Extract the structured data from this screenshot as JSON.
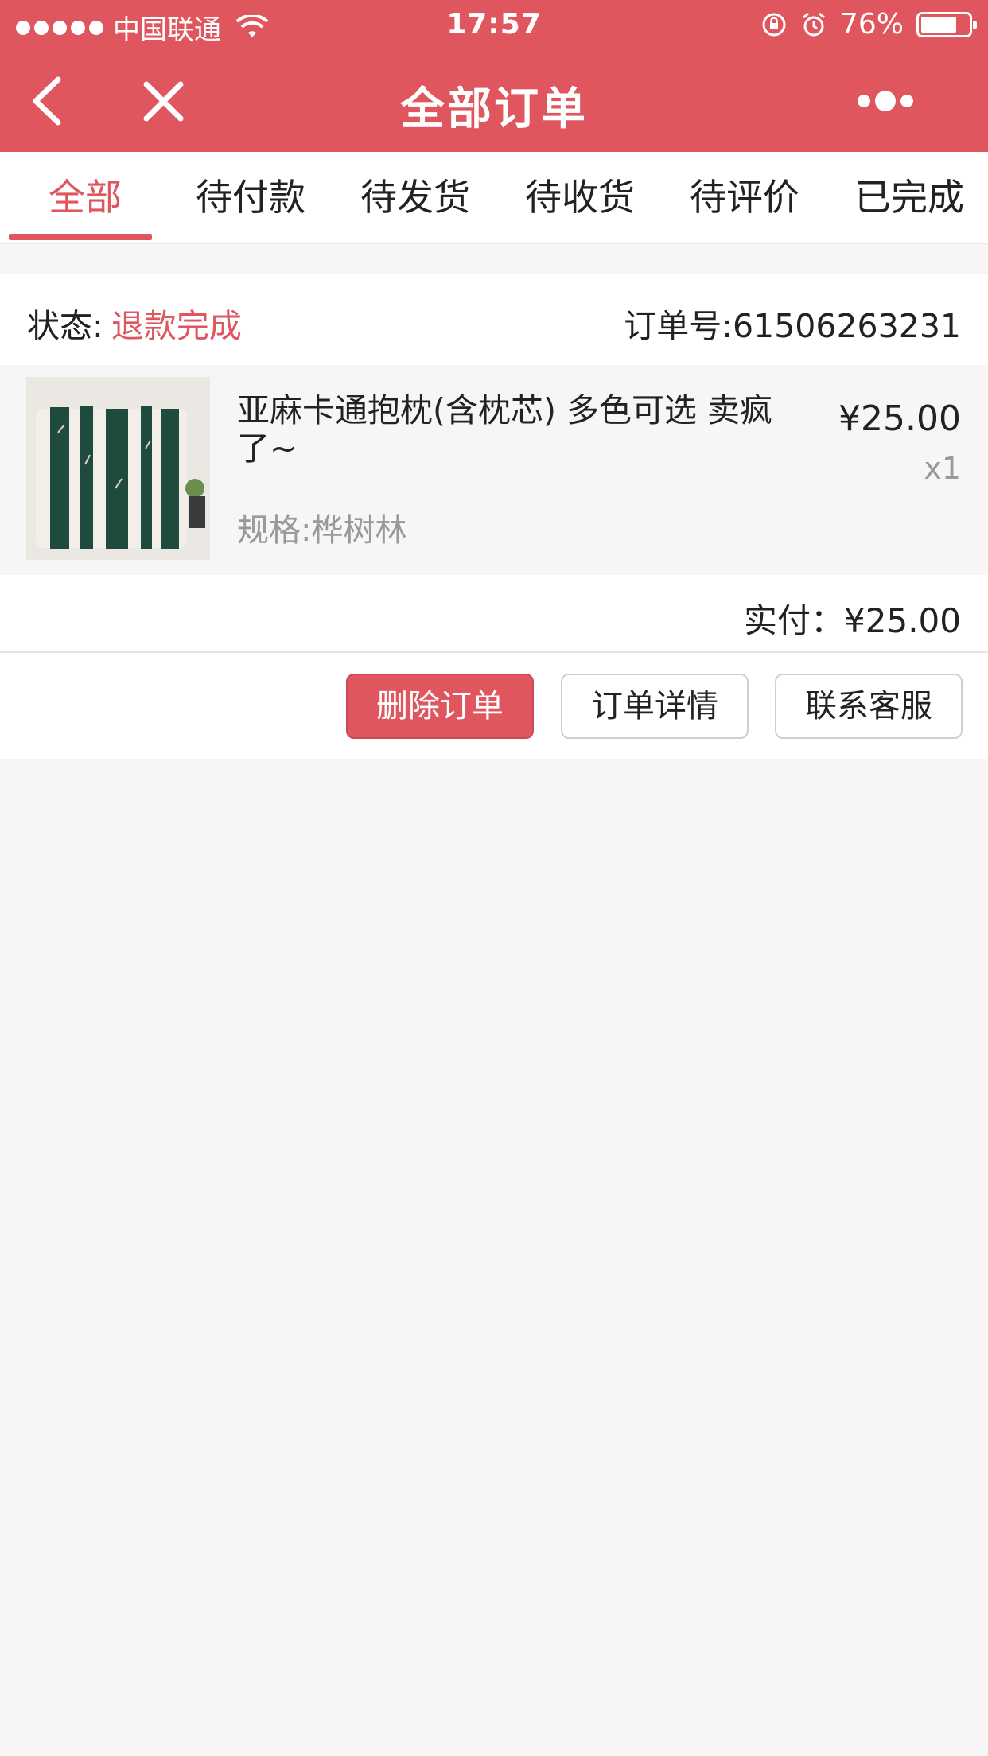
{
  "status_bar": {
    "carrier": "中国联通",
    "time": "17:57",
    "battery": "76%",
    "battery_level": 0.76
  },
  "nav": {
    "title": "全部订单",
    "back_icon": "chevron-left-icon",
    "close_icon": "close-icon",
    "more_icon": "more-dots-icon"
  },
  "tabs": [
    {
      "label": "全部",
      "active": true
    },
    {
      "label": "待付款",
      "active": false
    },
    {
      "label": "待发货",
      "active": false
    },
    {
      "label": "待收货",
      "active": false
    },
    {
      "label": "待评价",
      "active": false
    },
    {
      "label": "已完成",
      "active": false
    }
  ],
  "order": {
    "status_label": "状态:",
    "status_value": "退款完成",
    "order_no": "订单号:61506263231",
    "item": {
      "name": "亚麻卡通抱枕(含枕芯) 多色可选 卖疯了~",
      "spec": "规格:桦树林",
      "price": "¥25.00",
      "qty": "x1"
    },
    "paid": "实付：¥25.00",
    "buttons": {
      "delete": "删除订单",
      "detail": "订单详情",
      "service": "联系客服"
    }
  },
  "colors": {
    "accent": "#df565f",
    "background": "#f6f6f6",
    "muted_text": "#999999"
  }
}
